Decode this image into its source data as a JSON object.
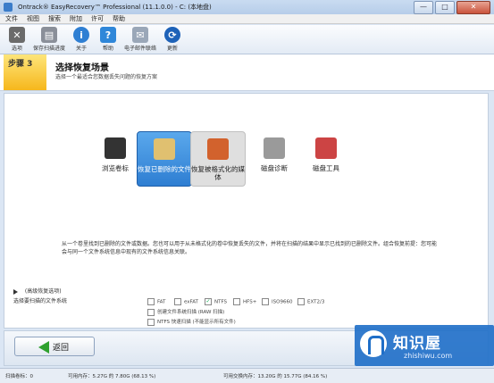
{
  "window": {
    "title": "Ontrack® EasyRecovery™ Professional (11.1.0.0) - C: (本地盘)",
    "buttons": [
      "—",
      "□",
      "✕"
    ]
  },
  "menu": [
    "文件",
    "视图",
    "搜索",
    "附加",
    "许可",
    "帮助"
  ],
  "toolbar": [
    {
      "label": "选项",
      "icon": "tools-icon",
      "color": "#6b6b6b"
    },
    {
      "label": "保存扫描进度",
      "icon": "save-icon",
      "color": "#8a8f99"
    },
    {
      "label": "关于",
      "icon": "info-icon",
      "color": "#2f7fd3"
    },
    {
      "label": "帮助",
      "icon": "help-icon",
      "color": "#2f87d9"
    },
    {
      "label": "电子邮件联络",
      "icon": "envelope-icon",
      "color": "#9aa7b8"
    },
    {
      "label": "更新",
      "icon": "update-icon",
      "color": "#1e62b8"
    }
  ],
  "step": {
    "badge": "步骤 3",
    "title": "选择恢复场景",
    "subtitle": "选择一个最适合您数据丢失问题的恢复方案"
  },
  "scenarios": [
    {
      "label": "浏览卷标",
      "icon": "binoculars-icon",
      "state": "normal"
    },
    {
      "label": "恢复已删除的文件",
      "icon": "deleted-files-icon",
      "state": "selected"
    },
    {
      "label": "恢复被格式化的媒体",
      "icon": "formatted-media-icon",
      "state": "hover"
    },
    {
      "label": "磁盘诊断",
      "icon": "disk-diagnostic-icon",
      "state": "normal"
    },
    {
      "label": "磁盘工具",
      "icon": "disk-tools-icon",
      "state": "normal"
    }
  ],
  "description": "从一个卷里找到已删除的文件或数据。您也可以用于从未格式化的卷中恢复丢失的文件，并将在扫描的结果中显示已找到的已删除文件。组合恢复前提：您可能会与同一个文件系统信息中现有的文件系统信息关联。",
  "advanced_label": "(高级恢复选项)",
  "filesystem_label": "选择要扫描的文件系统",
  "filesystems": [
    {
      "label": "FAT",
      "checked": false
    },
    {
      "label": "exFAT",
      "checked": false
    },
    {
      "label": "NTFS",
      "checked": true
    },
    {
      "label": "HFS+",
      "checked": false
    },
    {
      "label": "ISO9660",
      "checked": false
    },
    {
      "label": "EXT2/3",
      "checked": false
    },
    {
      "label": "创建文件系统扫描 (RAW 扫描)",
      "checked": false
    },
    {
      "label": "NTFS 快速扫描 (不能显示所有文件)",
      "checked": false
    }
  ],
  "back_button": "返回",
  "status": {
    "left": "扫描卷标：0",
    "middle": "可用内存：5.27G 的 7.80G (68.13 %)",
    "right": "可用交换内存：13.20G 的 15.77G (84.16 %)"
  },
  "watermark": {
    "text": "知识屋",
    "url": "zhishiwu.com"
  }
}
